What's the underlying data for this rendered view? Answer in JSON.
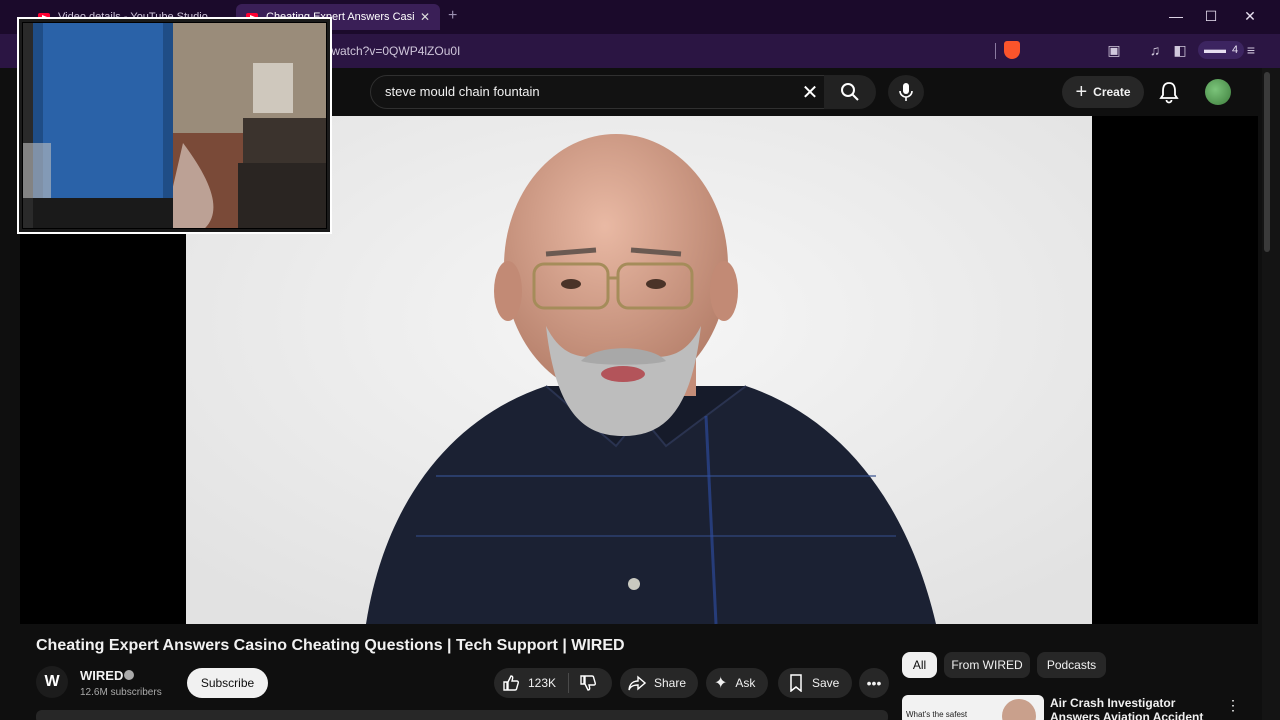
{
  "browser": {
    "tabs": [
      {
        "label": "Video details - YouTube Studio",
        "active": false
      },
      {
        "label": "Cheating Expert Answers Casi",
        "active": true
      }
    ],
    "new_tab_icon": "plus-icon",
    "url": "m/watch?v=0QWP4lZOu0I",
    "extension_badge": "4",
    "window_controls": [
      "minimize-icon",
      "maximize-icon",
      "close-icon"
    ]
  },
  "youtube": {
    "search": {
      "value": "steve mould chain fountain"
    },
    "create_label": "Create",
    "video": {
      "title": "Cheating Expert Answers Casino Cheating Questions | Tech Support | WIRED",
      "channel": {
        "name": "WIRED",
        "logo_letter": "W",
        "subscribers": "12.6M subscribers"
      },
      "subscribe_label": "Subscribe",
      "likes": "123K",
      "share_label": "Share",
      "ask_label": "Ask",
      "save_label": "Save"
    },
    "chips": [
      "All",
      "From WIRED",
      "Podcasts"
    ],
    "recommendation": {
      "title": "Air Crash Investigator Answers Aviation Accident Questions |",
      "thumb_text": "What's the safest"
    }
  },
  "colors": {
    "accent": "#ff0033",
    "chrome": "#2b1543",
    "tabbar": "#1b0a2b",
    "page": "#0f0f0f"
  }
}
